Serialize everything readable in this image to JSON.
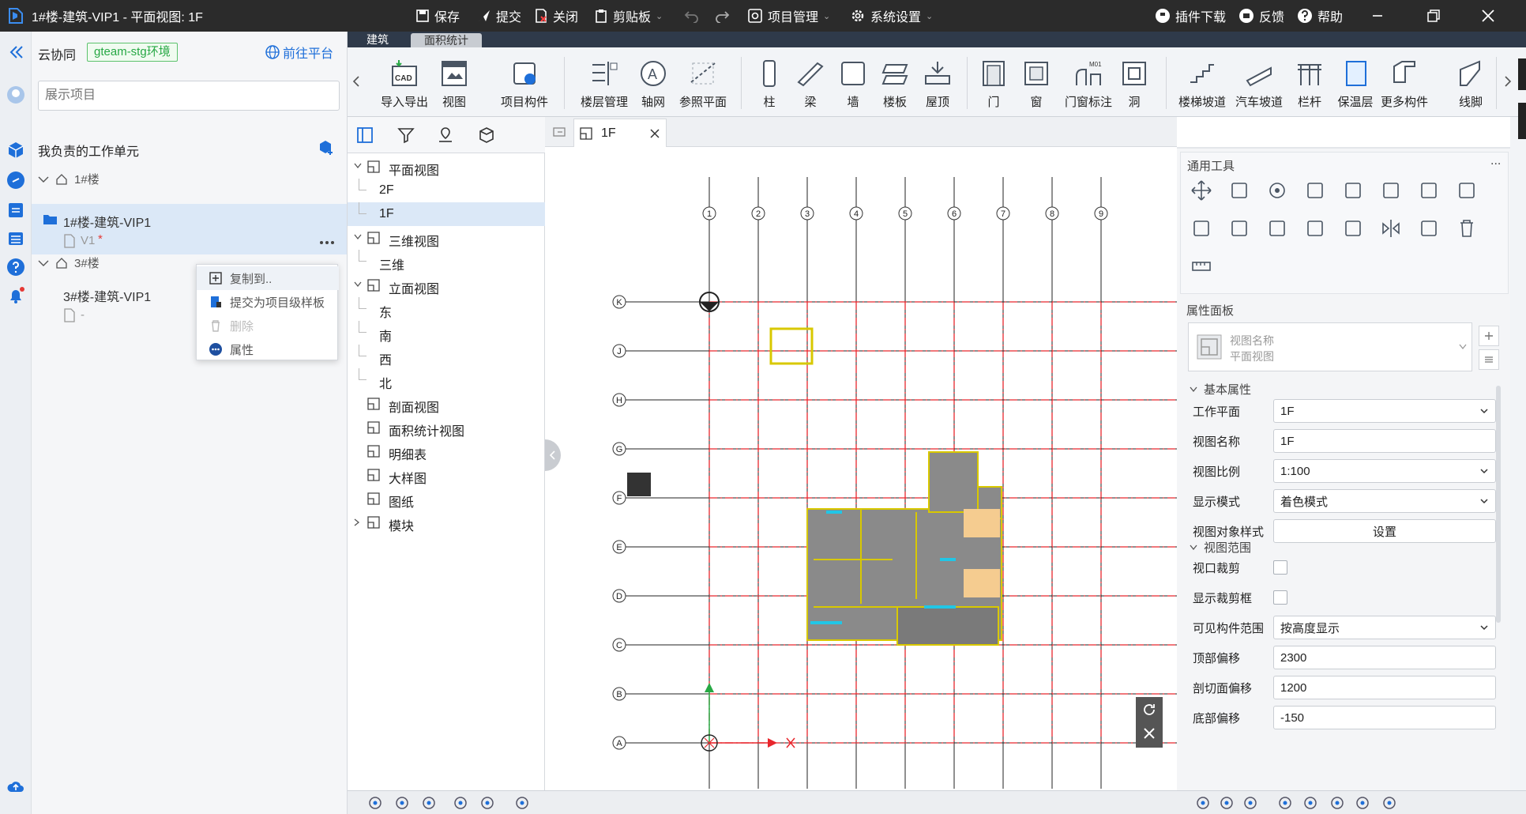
{
  "window": {
    "title": "1#楼-建筑-VIP1 - 平面视图: 1F",
    "toolbar": {
      "save": "保存",
      "submit": "提交",
      "close": "关闭",
      "clipboard": "剪贴板",
      "project_mgmt": "项目管理",
      "system_settings": "系统设置"
    },
    "right": {
      "plugin_download": "插件下载",
      "feedback": "反馈",
      "help": "帮助"
    }
  },
  "project_panel": {
    "title": "云协同",
    "env_badge": "gteam-stg环境",
    "goto_platform": "前往平台",
    "search_placeholder": "展示项目",
    "section_title": "我负责的工作单元",
    "group1": "1#楼",
    "unit1": "1#楼-建筑-VIP1",
    "unit1_version": "V1",
    "unit1_modified": "*",
    "group2": "3#楼",
    "unit2": "3#楼-建筑-VIP1",
    "unit2_version": "-"
  },
  "context_menu": {
    "copy_to": "复制到..",
    "submit_template": "提交为项目级样板",
    "delete": "删除",
    "properties": "属性"
  },
  "ribbon": {
    "tabs": [
      "建筑",
      "面积统计"
    ],
    "buttons": [
      "导入导出",
      "视图",
      "项目构件",
      "楼层管理",
      "轴网",
      "参照平面",
      "柱",
      "梁",
      "墙",
      "楼板",
      "屋顶",
      "门",
      "窗",
      "门窗标注",
      "洞",
      "楼梯坡道",
      "汽车坡道",
      "栏杆",
      "保温层",
      "更多构件",
      "线脚"
    ]
  },
  "view_tree": {
    "items": [
      {
        "label": "平面视图",
        "level": 0,
        "expand": "v"
      },
      {
        "label": "2F",
        "level": 1
      },
      {
        "label": "1F",
        "level": 1,
        "selected": true
      },
      {
        "label": "三维视图",
        "level": 0,
        "expand": "v"
      },
      {
        "label": "三维",
        "level": 1
      },
      {
        "label": "立面视图",
        "level": 0,
        "expand": "v"
      },
      {
        "label": "东",
        "level": 1
      },
      {
        "label": "南",
        "level": 1
      },
      {
        "label": "西",
        "level": 1
      },
      {
        "label": "北",
        "level": 1
      },
      {
        "label": "剖面视图",
        "level": 0
      },
      {
        "label": "面积统计视图",
        "level": 0
      },
      {
        "label": "明细表",
        "level": 0
      },
      {
        "label": "大样图",
        "level": 0
      },
      {
        "label": "图纸",
        "level": 0
      },
      {
        "label": "模块",
        "level": 0,
        "expand": ">"
      }
    ]
  },
  "canvas": {
    "tab_label": "1F",
    "grid_cols": [
      "1",
      "2",
      "3",
      "4",
      "5",
      "6",
      "7",
      "8",
      "9"
    ],
    "grid_rows": [
      "K",
      "J",
      "H",
      "G",
      "F",
      "E",
      "D",
      "C",
      "B",
      "A"
    ]
  },
  "tools_panel": {
    "title": "通用工具",
    "more": "..."
  },
  "properties_panel": {
    "title": "属性面板",
    "view_type_name": "视图名称",
    "view_type_sub": "平面视图",
    "basic_section": "基本属性",
    "range_section": "视图范围",
    "fields": {
      "work_plane": {
        "label": "工作平面",
        "value": "1F"
      },
      "view_name": {
        "label": "视图名称",
        "value": "1F"
      },
      "view_scale": {
        "label": "视图比例",
        "value": "1:100"
      },
      "display_mode": {
        "label": "显示模式",
        "value": "着色模式"
      },
      "object_style": {
        "label": "视图对象样式",
        "value": "设置"
      },
      "viewport_crop": {
        "label": "视口裁剪"
      },
      "show_crop": {
        "label": "显示裁剪框"
      },
      "visible_range": {
        "label": "可见构件范围",
        "value": "按高度显示"
      },
      "top_offset": {
        "label": "顶部偏移",
        "value": "2300"
      },
      "cut_offset": {
        "label": "剖切面偏移",
        "value": "1200"
      },
      "bottom_offset": {
        "label": "底部偏移",
        "value": "-150"
      }
    }
  },
  "colors": {
    "accent": "#1e6fd9",
    "grid_red": "#e8262c",
    "titlebar": "#2b2b2b",
    "badge_green": "#27a844",
    "highlight": "#dbe8f7"
  }
}
